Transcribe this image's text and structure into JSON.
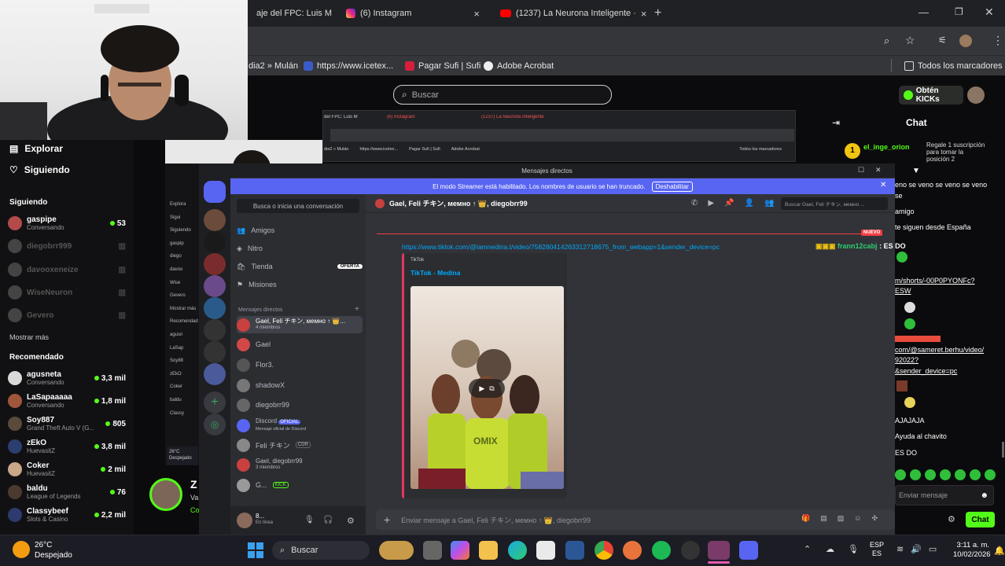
{
  "browser": {
    "tabs": [
      {
        "label": "aje del FPC: Luis M",
        "icon": "site-icon"
      },
      {
        "label": "(6) Instagram",
        "icon": "instagram-icon"
      },
      {
        "label": "(1237) La Neurona Inteligente ·",
        "icon": "youtube-icon"
      }
    ],
    "bookmarks": [
      {
        "label": "dia2 » Mulán",
        "icon": "bookmark-icon"
      },
      {
        "label": "https://www.icetex...",
        "icon": "icetex-icon"
      },
      {
        "label": "Pagar Sufi | Sufi",
        "icon": "sufi-icon"
      },
      {
        "label": "Adobe Acrobat",
        "icon": "adobe-icon"
      }
    ],
    "all_bookmarks_label": "Todos los marcadores"
  },
  "kick": {
    "search_placeholder": "Buscar",
    "get_kicks_label": "Obtén KICKs",
    "chat_title": "Chat",
    "gift": {
      "rank": "1",
      "user": "el_inge_orion",
      "text": "Regale 1 suscripción para tomar la posición 2"
    },
    "nav": [
      {
        "label": "Explorar",
        "icon": "explore-icon"
      },
      {
        "label": "Siguiendo",
        "icon": "heart-icon"
      }
    ],
    "following_title": "Siguiendo",
    "following": [
      {
        "name": "gaspipe",
        "status": "Conversando",
        "viewers": "53",
        "live": true
      },
      {
        "name": "diegobrr999",
        "status": "",
        "viewers": "",
        "live": false
      },
      {
        "name": "davooxeneize",
        "status": "",
        "viewers": "",
        "live": false
      },
      {
        "name": "WiseNeuron",
        "status": "",
        "viewers": "",
        "live": false
      },
      {
        "name": "Gevero",
        "status": "",
        "viewers": "",
        "live": false
      }
    ],
    "show_more": "Mostrar más",
    "recommended_title": "Recomendado",
    "recommended": [
      {
        "name": "agusneta",
        "status": "Conversando",
        "viewers": "3,3 mil"
      },
      {
        "name": "LaSapaaaaa",
        "status": "Conversando",
        "viewers": "1,8 mil"
      },
      {
        "name": "Soy887",
        "status": "Grand Theft Auto V (G...",
        "viewers": "805"
      },
      {
        "name": "zEkO",
        "status": "HuevasitZ",
        "viewers": "3,8 mil"
      },
      {
        "name": "Coker",
        "status": "HuevasitZ",
        "viewers": "2 mil"
      },
      {
        "name": "baldu",
        "status": "League of Legends",
        "viewers": "76"
      },
      {
        "name": "Classybeef",
        "status": "Slots & Casino",
        "viewers": "2,2 mil"
      }
    ],
    "chat_lines": [
      {
        "text": "eno se veno se veno se veno",
        "color": "#ffffff"
      },
      {
        "text": "se",
        "color": "#ffffff"
      },
      {
        "text": "amigo",
        "color": "#ffffff"
      },
      {
        "text": "te siguen desde España",
        "color": "#ffffff"
      },
      {
        "text": "ES DO",
        "color": "#ffffff"
      },
      {
        "text": "m/shorts/-00P0PYONFc?",
        "color": "#ffffff"
      },
      {
        "text": "ESW",
        "color": "#ffffff"
      },
      {
        "text": "AJAJAJA",
        "color": "#ffffff"
      },
      {
        "text": "Ayuda al chavito",
        "color": "#ffffff"
      },
      {
        "text": "ES DO",
        "color": "#ffffff"
      }
    ],
    "chat_links": [
      {
        "text": "com/@sameret.berhu/video/",
        "color": "#ffffff"
      },
      {
        "text": "92022?",
        "color": "#ffffff"
      },
      {
        "text": "&sender_device=pc",
        "color": "#ffffff"
      }
    ],
    "chat_user": {
      "name": "frann12cabj",
      "message": "ES DO",
      "color": "#2ecc71"
    },
    "chat_input_placeholder": "Enviar mensaje",
    "chat_button": "Chat",
    "accent": "#53fc18"
  },
  "discord": {
    "window_title": "Mensajes directos",
    "banner_text": "El modo Streamer está habilitado. Los nombres de usuario se han truncado.",
    "banner_button": "Deshabilitar",
    "find_placeholder": "Busca o inicia una conversación",
    "nav": [
      {
        "label": "Amigos",
        "icon": "friends-icon"
      },
      {
        "label": "Nitro",
        "icon": "nitro-icon"
      },
      {
        "label": "Tienda",
        "icon": "shop-icon",
        "badge": "OFERTA"
      },
      {
        "label": "Misiones",
        "icon": "quests-icon"
      }
    ],
    "dm_header": "Mensajes directos",
    "dms": [
      {
        "name": "Gael, Feli チキン, мемно ↑ 👑...",
        "sub": "4 miembros",
        "tag": ""
      },
      {
        "name": "Gael",
        "sub": "",
        "tag": ""
      },
      {
        "name": "Flor3.",
        "sub": "",
        "tag": ""
      },
      {
        "name": "shadowX",
        "sub": "",
        "tag": ""
      },
      {
        "name": "diegobrr99",
        "sub": "",
        "tag": ""
      },
      {
        "name": "Discord",
        "sub": "Mensaje oficial de Discord",
        "tag": "OFICIAL"
      },
      {
        "name": "Feli チキン",
        "sub": "",
        "tag": "CDR"
      },
      {
        "name": "Gael, diegobrr99",
        "sub": "3 miembros",
        "tag": ""
      },
      {
        "name": "G...",
        "sub": "",
        "tag": "KICK"
      }
    ],
    "user_name": "8...",
    "user_status": "En línea",
    "header_title": "Gael, Feli チキン, мемно ↑ 👑, diegobrr99",
    "header_search": "Buscar Gael, Feli チキン, мемно ...",
    "new_label": "NUEVO",
    "link_text": "https://www.tiktok.com/@iamnedina.t/video/758280414263312718675_from_webapp=1&sender_device=pc",
    "embed_provider": "TikTok",
    "embed_title": "TikTok - Medina",
    "video_text": "OMIX",
    "message_placeholder": "Enviar mensaje a Gael, Feli チキン, мемно ↑ 👑, diegobrr99",
    "accent": "#5865f2"
  },
  "inner_browser": {
    "tabs": [
      "del FPC: Luis M",
      "(6) Instagram",
      "(1237) La Neurona Inteligente"
    ],
    "bookmarks": [
      "dia2 » Mulán",
      "https://www.icetex...",
      "Pagar Sufi | Sufi",
      "Adobe Acrobat"
    ],
    "all_bookmarks": "Todos los marcadores"
  },
  "inner_kick": {
    "items": [
      "Explora",
      "Sigui",
      "Siguiendo",
      "gaspip",
      "diego",
      "davoo",
      "Wise",
      "Gevero",
      "Mostrar más",
      "Recomendad",
      "agusn",
      "LaSap",
      "Soy88",
      "zEkO",
      "Coker",
      "baldu",
      "Classy"
    ],
    "weather": "26°C Despejado"
  },
  "stream": {
    "name_initial": "Z",
    "sub": "Va",
    "sub2": "Co"
  },
  "taskbar": {
    "weather_temp": "26°C",
    "weather_desc": "Despejado",
    "search_label": "Buscar",
    "lang_top": "ESP",
    "lang_bottom": "ES",
    "time": "3:11 a. m.",
    "date": "10/02/2026"
  }
}
